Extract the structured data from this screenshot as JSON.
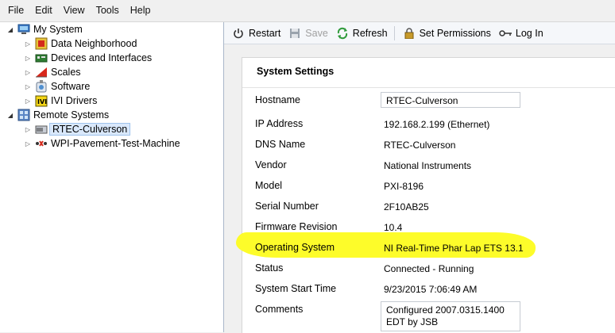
{
  "menu": [
    "File",
    "Edit",
    "View",
    "Tools",
    "Help"
  ],
  "tree": {
    "my_system": {
      "label": "My System",
      "children": [
        "Data Neighborhood",
        "Devices and Interfaces",
        "Scales",
        "Software",
        "IVI Drivers"
      ]
    },
    "remote_systems": {
      "label": "Remote Systems",
      "children": [
        "RTEC-Culverson",
        "WPI-Pavement-Test-Machine"
      ]
    }
  },
  "toolbar": {
    "restart": "Restart",
    "save": "Save",
    "refresh": "Refresh",
    "set_permissions": "Set Permissions",
    "log_in": "Log In"
  },
  "settings": {
    "title": "System Settings",
    "hostname_label": "Hostname",
    "hostname_value": "RTEC-Culverson",
    "ip_label": "IP Address",
    "ip_value": "192.168.2.199 (Ethernet)",
    "dns_label": "DNS Name",
    "dns_value": "RTEC-Culverson",
    "vendor_label": "Vendor",
    "vendor_value": "National Instruments",
    "model_label": "Model",
    "model_value": "PXI-8196",
    "serial_label": "Serial Number",
    "serial_value": "2F10AB25",
    "firmware_label": "Firmware Revision",
    "firmware_value": "10.4",
    "os_label": "Operating System",
    "os_value": "NI Real-Time Phar Lap ETS 13.1",
    "status_label": "Status",
    "status_value": "Connected - Running",
    "start_label": "System Start Time",
    "start_value": "9/23/2015 7:06:49 AM",
    "comments_label": "Comments",
    "comments_value": "Configured 2007.0315.1400\nEDT by JSB"
  },
  "colors": {
    "highlight": "#fdfc2a",
    "selection": "#d9e8fb"
  }
}
